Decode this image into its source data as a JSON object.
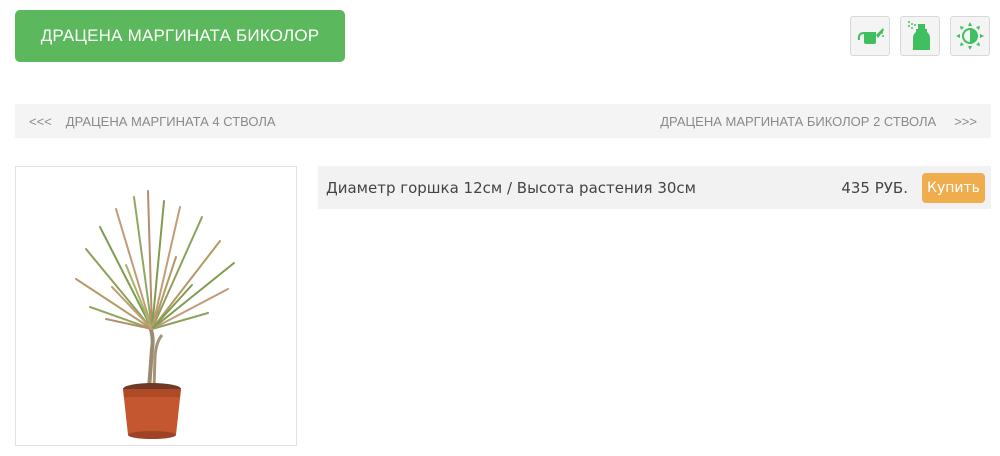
{
  "product": {
    "title": "ДРАЦЕНА МАРГИНАТА БИКОЛОР",
    "care_icons": [
      {
        "name": "watering-can-icon",
        "color": "#3fbf5f"
      },
      {
        "name": "spray-bottle-icon",
        "color": "#3fbf5f"
      },
      {
        "name": "sun-icon",
        "color": "#3fbf5f"
      }
    ],
    "image": "plant-photo"
  },
  "navigation": {
    "prev_arrow": "<<<",
    "prev_label": "ДРАЦЕНА МАРГИНАТА 4 СТВОЛА",
    "next_label": "ДРАЦЕНА МАРГИНАТА БИКОЛОР 2 СТВОЛА",
    "next_arrow": ">>>"
  },
  "variants": [
    {
      "description": "Диаметр горшка 12см / Высота растения 30см",
      "price": "435 РУБ.",
      "buy_label": "Купить"
    }
  ],
  "colors": {
    "title_bg": "#5cb85c",
    "buy_bg": "#f0ad4e",
    "nav_bg": "#f4f4f4"
  }
}
